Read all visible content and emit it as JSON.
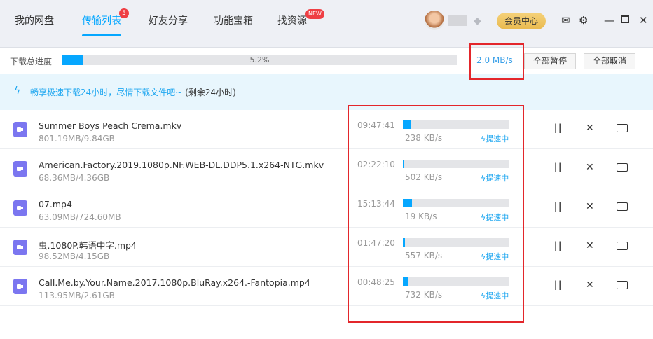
{
  "tabs": [
    {
      "label": "我的网盘"
    },
    {
      "label": "传输列表",
      "badge": "5"
    },
    {
      "label": "好友分享"
    },
    {
      "label": "功能宝箱"
    },
    {
      "label": "找资源",
      "badge": "NEW"
    }
  ],
  "header": {
    "vip_label": "会员中心"
  },
  "progress": {
    "label": "下载总进度",
    "percent_text": "5.2%",
    "percent": 5.2,
    "speed": "2.0 MB/s",
    "pause_all": "全部暂停",
    "cancel_all": "全部取消"
  },
  "banner": {
    "text": "畅享极速下载24小时，尽情下载文件吧~",
    "remaining": "(剩余24小时)"
  },
  "boost_label": "提速中",
  "files": [
    {
      "name": "Summer Boys Peach Crema.mkv",
      "size": "801.19MB/9.84GB",
      "eta": "09:47:41",
      "speed": "238 KB/s",
      "progress": 8
    },
    {
      "name": "American.Factory.2019.1080p.NF.WEB-DL.DDP5.1.x264-NTG.mkv",
      "size": "68.36MB/4.36GB",
      "eta": "02:22:10",
      "speed": "502 KB/s",
      "progress": 1.5
    },
    {
      "name": "07.mp4",
      "size": "63.09MB/724.60MB",
      "eta": "15:13:44",
      "speed": "19 KB/s",
      "progress": 8.7
    },
    {
      "name": "虫.1080P.韩语中字.mp4",
      "size": "98.52MB/4.15GB",
      "eta": "01:47:20",
      "speed": "557 KB/s",
      "progress": 2.3
    },
    {
      "name": "Call.Me.by.Your.Name.2017.1080p.BluRay.x264.-Fantopia.mp4",
      "size": "113.95MB/2.61GB",
      "eta": "00:48:25",
      "speed": "732 KB/s",
      "progress": 4.3
    }
  ],
  "colors": {
    "accent": "#06a7ff",
    "highlight_box": "#e3262b",
    "file_icon": "#7b76f0"
  }
}
